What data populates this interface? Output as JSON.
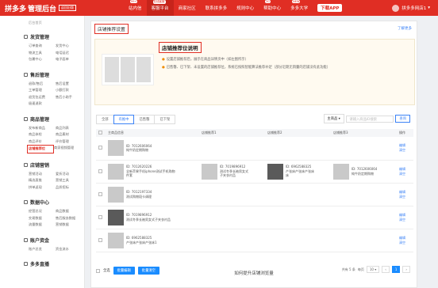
{
  "topbar": {
    "logo": "拼多多",
    "logo_sub": "管理后台",
    "version": "返回旧版",
    "nav": [
      {
        "label": "站内信",
        "badge": "99+"
      },
      {
        "label": "客服平台",
        "badge": "在线客服",
        "active": true
      },
      {
        "label": "商家社区"
      },
      {
        "label": "联系拼多多"
      },
      {
        "label": "规则中心"
      },
      {
        "label": "帮助中心",
        "badge": "30"
      },
      {
        "label": "多多大学",
        "badge": "NEW"
      }
    ],
    "download": "下载APP",
    "user": "拼多多网店1"
  },
  "sidebar": {
    "crumb": "后台首页",
    "groups": [
      {
        "title": "发货管理",
        "items": [
          [
            "订单查询",
            "发货中心"
          ],
          [
            "物流工具",
            "电话延迟"
          ],
          [
            "包裹中心",
            "电子面单"
          ]
        ]
      },
      {
        "title": "售后管理",
        "items": [
          [
            "退款/售后",
            "售后设置"
          ],
          [
            "工单管理",
            "小额打款"
          ],
          [
            "退货包运费",
            "售后小助手"
          ],
          [
            "极速退款",
            ""
          ]
        ]
      },
      {
        "title": "商品管理",
        "items": [
          [
            "发布新商品",
            "商品列表"
          ],
          [
            "商品体检",
            "商品素材"
          ],
          [
            "商品评价",
            "评价管理"
          ],
          [
            "店铺推荐位",
            "商家视频管理"
          ]
        ]
      },
      {
        "title": "店铺营销",
        "items": [
          [
            "营销活动",
            "爱折活动"
          ],
          [
            "精选直推",
            "营销工具"
          ],
          [
            "拼单返现",
            "品质招标"
          ]
        ]
      },
      {
        "title": "数据中心",
        "items": [
          [
            "经营总况",
            "商品数据"
          ],
          [
            "交易数据",
            "售后服务数据"
          ],
          [
            "流量数据",
            "营销数据"
          ]
        ]
      },
      {
        "title": "账户资金",
        "items": [
          [
            "账户总览",
            "资金流水"
          ]
        ]
      },
      {
        "title": "多多直播",
        "items": []
      }
    ],
    "current": "店铺推荐位"
  },
  "main": {
    "title": "店铺推荐设置",
    "learn_more": "了解更多",
    "info_title": "店铺推荐位说明",
    "lines": [
      "设置店铺推荐后，展示在商品详情页中（如左图所示）",
      "已售罄、已下架、未设置的店铺推荐位，系统已按照智能算法推荐补足（部分近期无销量的店铺没有此功能）"
    ],
    "filters": [
      "全部",
      "有推中",
      "已售罄",
      "已下架"
    ],
    "filter_active": 1,
    "search_select": "主商品",
    "search_placeholder": "请输入商品ID搜索",
    "search_button": "查询",
    "columns": [
      "主商品信息",
      "店铺推荐1",
      "店铺推荐2",
      "店铺推荐3",
      "操作"
    ],
    "rows": [
      {
        "main": [
          "ID: 7012606064",
          "纯牛奶定期购物"
        ],
        "r1": [],
        "r2": [],
        "r3": []
      },
      {
        "main": [
          "ID: 7012620226",
          "全新苹果手机iphone测试手机购物",
          "件套"
        ],
        "r1": [
          "ID: 7019896912",
          "测试冬季长袖男女式",
          "子夹衣衬品"
        ],
        "r2": [
          "ID: 6962588325",
          "产张床产张床产张床",
          "床"
        ],
        "r3": [
          "ID: 7012606064",
          "纯牛奶定期购物"
        ]
      },
      {
        "main": [
          "ID: 7012197334",
          "测试购物段卡调理"
        ],
        "r1": [],
        "r2": [],
        "r3": []
      },
      {
        "main": [
          "ID: 7019896912",
          "测试冬季长袖男女式子夹衣衬品"
        ],
        "r1": [],
        "r2": [],
        "r3": []
      },
      {
        "main": [
          "ID: 6962588325",
          "产张床产张床产张床1"
        ],
        "r1": [],
        "r2": [],
        "r3": []
      }
    ],
    "op_edit": "编辑",
    "op_clear": "清空",
    "select_all": "全选",
    "batch_edit": "批量编辑",
    "batch_clear": "批量清空",
    "total": "共有 5 条",
    "per_page_label": "每页",
    "per_page": "10",
    "page": "1",
    "footer_title": "如何提升店铺浏览量"
  }
}
